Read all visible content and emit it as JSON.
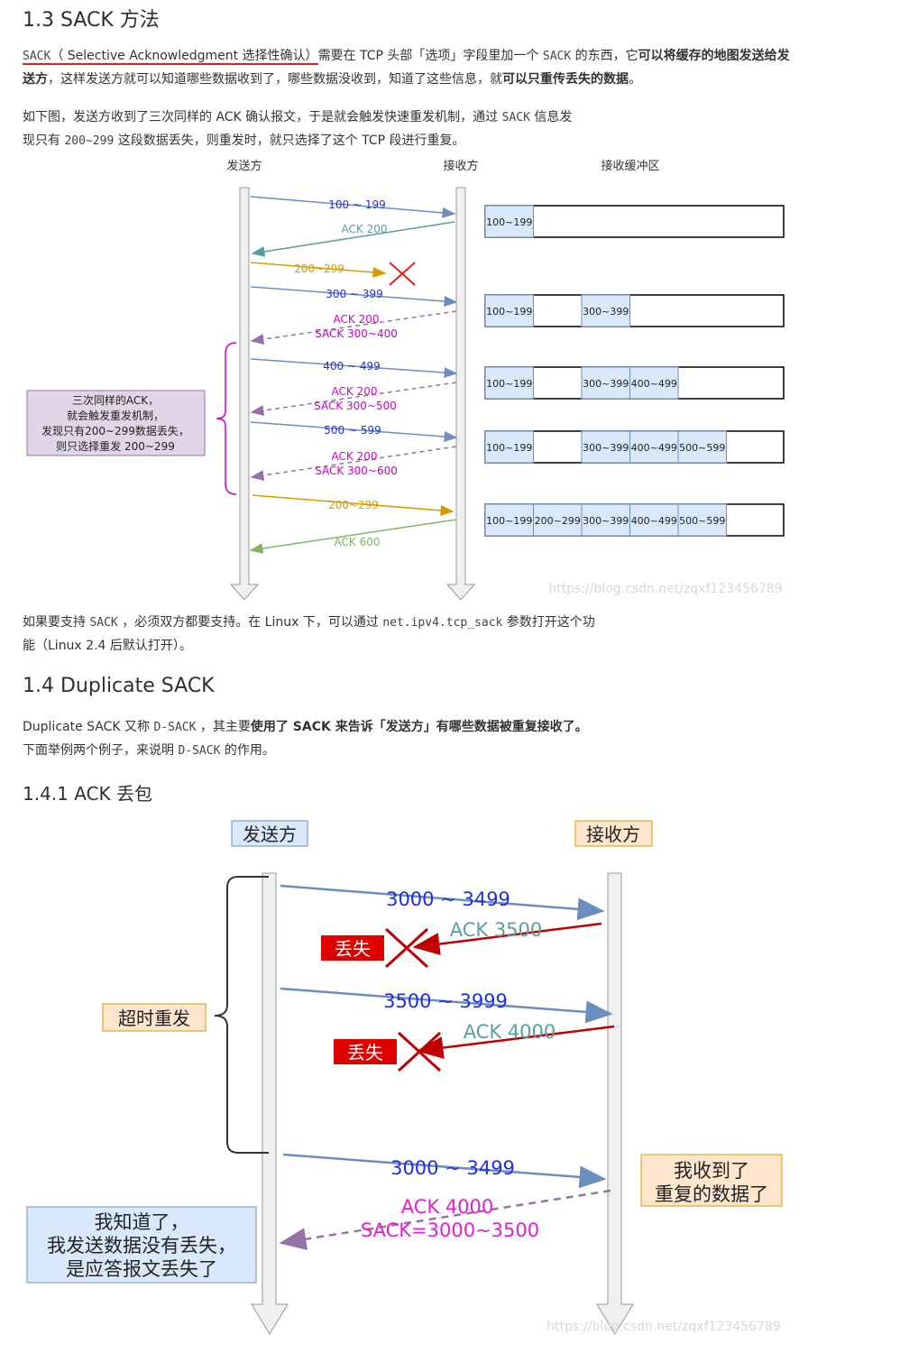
{
  "sec13": {
    "title": "1.3 SACK 方法",
    "p1a_code": "SACK",
    "p1b": "（ Selective Acknowledgment 选择性确认）",
    "p1c": "需要在 TCP 头部「选项」字段里加一个 ",
    "p1d_code": "SACK",
    "p1e": " 的东西，它",
    "p1f_bold": "可以将缓存的地图发送给发",
    "p1g_bold": "送方",
    "p1h": "，这样发送方就可以知道哪些数据收到了，哪些数据没收到，知道了这些信息，就",
    "p1i_bold": "可以只重传丢失的数据",
    "p1j": "。",
    "p2a": "如下图，发送方收到了三次同样的 ACK 确认报文，于是就会触发快速重发机制，通过 ",
    "p2b_code": "SACK",
    "p2c": " 信息发",
    "p2d": "现只有 ",
    "p2e_code": "200~299",
    "p2f": " 这段数据丢失，则重发时，就只选择了这个 TCP 段进行重复。"
  },
  "diagram1": {
    "sender": "发送方",
    "receiver": "接收方",
    "buffer": "接收缓冲区",
    "note": [
      "三次同样的ACK，",
      "就会触发重发机制，",
      "发现只有200~299数据丢失，",
      "则只选择重发 200~299"
    ],
    "msgs": [
      "100 ~ 199",
      "ACK 200",
      "200~299",
      "300 ~ 399",
      "ACK 200",
      "SACK 300~400",
      "400 ~ 499",
      "ACK 200",
      "SACK 300~500",
      "500 ~ 599",
      "ACK 200",
      "SACK 300~600",
      "200~299",
      "ACK 600"
    ],
    "rows": [
      [
        "100~199"
      ],
      [
        "100~199",
        "",
        "300~399"
      ],
      [
        "100~199",
        "",
        "300~399",
        "400~499"
      ],
      [
        "100~199",
        "",
        "300~399",
        "400~499",
        "500~599"
      ],
      [
        "100~199",
        "200~299",
        "300~399",
        "400~499",
        "500~599"
      ]
    ],
    "watermark": "https://blog.csdn.net/zqxf123456789"
  },
  "after": {
    "a": "如果要支持 ",
    "b_code": "SACK",
    "c": " ，必须双方都要支持。在 Linux 下，可以通过 ",
    "d_code": "net.ipv4.tcp_sack",
    "e": " 参数打开这个功",
    "f": "能（Linux 2.4 后默认打开）。"
  },
  "sec14": {
    "title": "1.4 Duplicate SACK",
    "p1a": "Duplicate SACK 又称 ",
    "p1b_code": "D-SACK",
    "p1c": " ，其主要",
    "p1d_bold": "使用了 SACK 来告诉「发送方」有哪些数据被重复接收了。",
    "p2a": "下面举例两个例子，来说明 ",
    "p2b_code": "D-SACK",
    "p2c": " 的作用。"
  },
  "sec141": {
    "title": "1.4.1 ACK 丢包"
  },
  "diagram2": {
    "sender": "发送方",
    "receiver": "接收方",
    "msgs": [
      "3000 ~ 3499",
      "ACK 3500",
      "3500 ~ 3999",
      "ACK 4000",
      "3000 ~ 3499",
      "ACK 4000",
      "SACK=3000~3500"
    ],
    "lost": "丢失",
    "timeout": "超时重发",
    "recv_note": [
      "我收到了",
      "重复的数据了"
    ],
    "send_note": [
      "我知道了，",
      "我发送数据没有丢失，",
      "是应答报文丢失了"
    ],
    "watermark": "https://blog.csdn.net/zqxf123456789"
  }
}
